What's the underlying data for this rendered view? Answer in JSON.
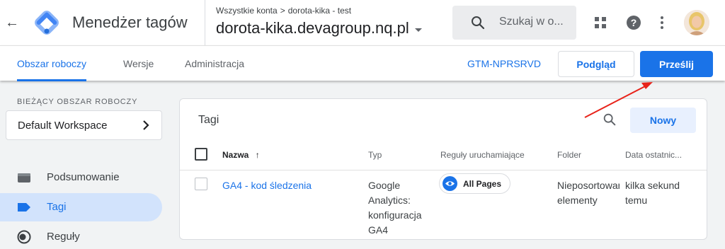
{
  "header": {
    "product_name": "Menedżer tagów",
    "breadcrumb": {
      "account": "Wszystkie konta",
      "separator": ">",
      "container_path": "dorota-kika - test"
    },
    "container_name": "dorota-kika.devagroup.nq.pl",
    "search_placeholder": "Szukaj w o...",
    "icons": [
      "back-arrow-icon",
      "gtm-logo",
      "search-icon",
      "apps-grid-icon",
      "help-icon",
      "more-vert-icon",
      "avatar"
    ]
  },
  "tabs": [
    {
      "label": "Obszar roboczy",
      "active": true
    },
    {
      "label": "Wersje",
      "active": false
    },
    {
      "label": "Administracja",
      "active": false
    }
  ],
  "toolbar": {
    "container_id": "GTM-NPRSRVD",
    "preview_label": "Podgląd",
    "submit_label": "Prześlij"
  },
  "sidebar": {
    "workspace_heading": "BIEŻĄCY OBSZAR ROBOCZY",
    "workspace_name": "Default Workspace",
    "items": [
      {
        "label": "Podsumowanie",
        "icon": "folder-icon",
        "active": false
      },
      {
        "label": "Tagi",
        "icon": "tag-icon",
        "active": true
      },
      {
        "label": "Reguły",
        "icon": "trigger-icon",
        "active": false
      }
    ]
  },
  "tags_panel": {
    "title": "Tagi",
    "new_label": "Nowy",
    "columns": [
      "Nazwa",
      "Typ",
      "Reguły uruchamiające",
      "Folder",
      "Data ostatnic..."
    ],
    "sort_indicator": "↑",
    "rows": [
      {
        "name": "GA4 - kod śledzenia",
        "type": "Google Analytics: konfiguracja GA4",
        "trigger": "All Pages",
        "folder": "Nieposortowane elementy",
        "last_edited": "kilka sekund temu"
      }
    ]
  },
  "colors": {
    "accent": "#1a73e8",
    "active_nav_bg": "#d2e3fc",
    "body_bg": "#f1f3f4",
    "annotation_arrow": "#e8231a"
  }
}
